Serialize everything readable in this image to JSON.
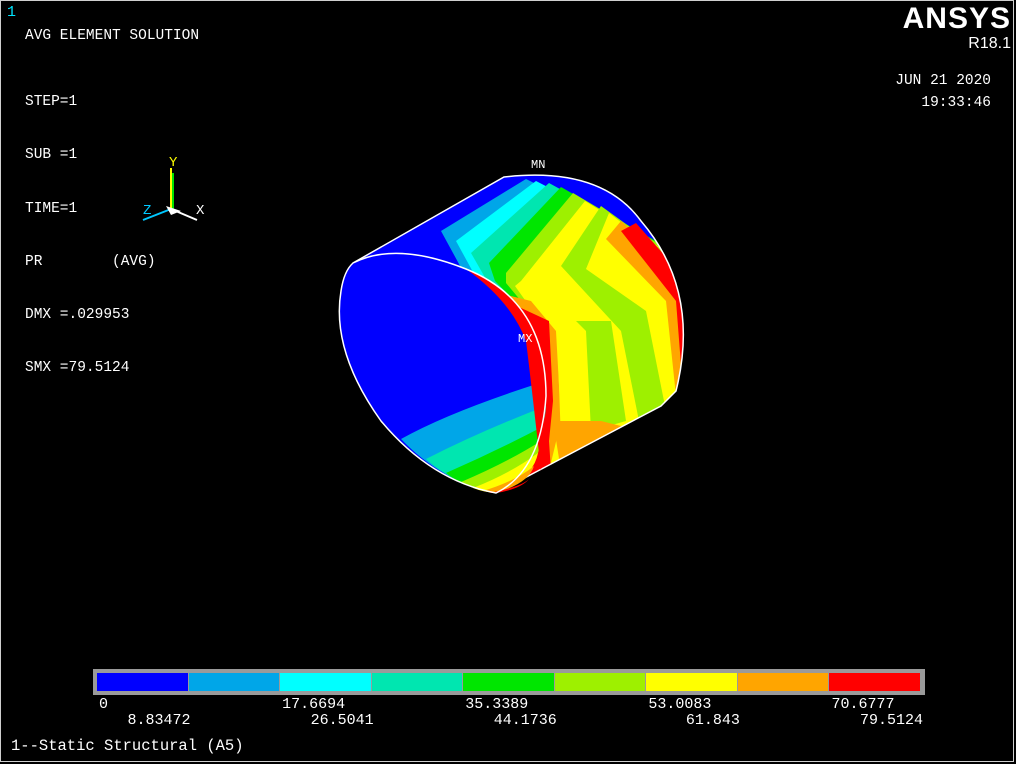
{
  "window_number": "1",
  "result_title": "AVG ELEMENT SOLUTION",
  "info_lines": [
    "STEP=1",
    "SUB =1",
    "TIME=1",
    "PR        (AVG)",
    "DMX =.029953",
    "SMX =79.5124"
  ],
  "brand": {
    "name": "ANSYS",
    "version": "R18.1"
  },
  "date": "JUN 21 2020",
  "time": "19:33:46",
  "triad": {
    "y_label": "Y",
    "x_label": "X",
    "z_label": "Z"
  },
  "markers": {
    "min": "MN",
    "max": "MX"
  },
  "legend": {
    "colors": [
      "#0000ff",
      "#00a6e8",
      "#00ffff",
      "#00e6b0",
      "#00e600",
      "#9ef000",
      "#ffff00",
      "#ffa500",
      "#ff0000"
    ],
    "labels_top": [
      "0",
      "17.6694",
      "35.3389",
      "53.0083",
      "70.6777"
    ],
    "labels_bottom": [
      "8.83472",
      "26.5041",
      "44.1736",
      "61.843",
      "79.5124"
    ]
  },
  "caption": "1--Static Structural (A5)"
}
